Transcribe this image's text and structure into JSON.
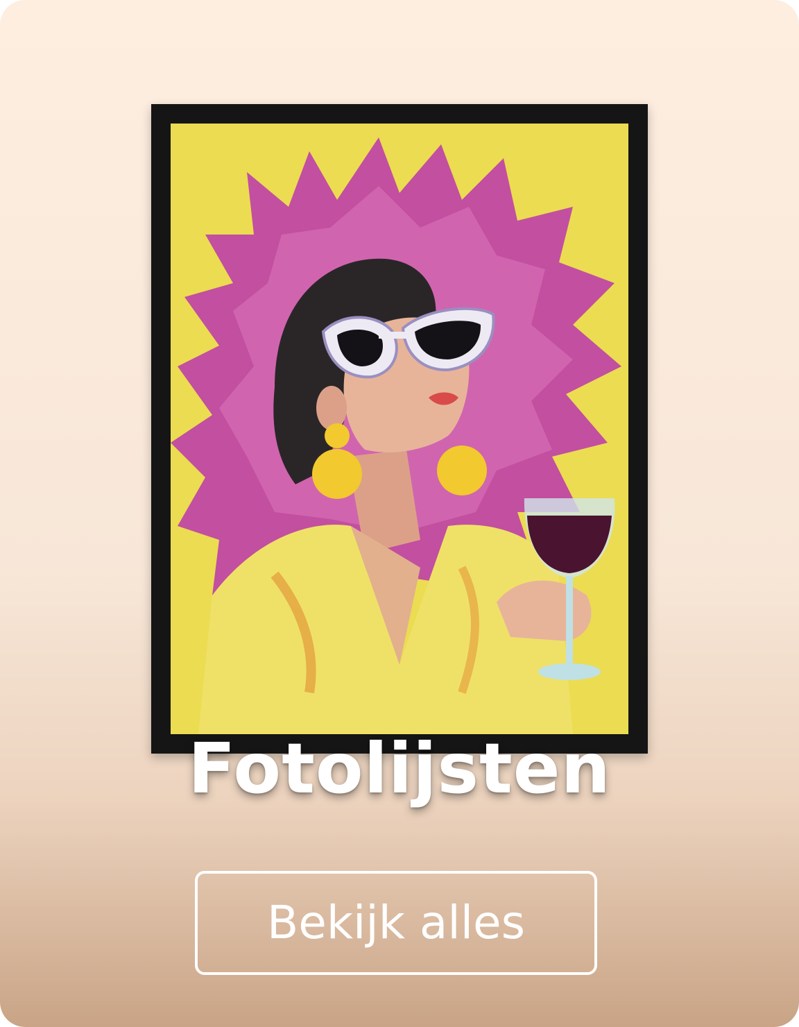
{
  "card": {
    "title": "Fotolijsten",
    "cta_label": "Bekijk alles"
  },
  "artwork": {
    "icon": "framed-poster-image",
    "colors": {
      "frame": "#151515",
      "background": "#e9d84a",
      "splash": "#c24fa0",
      "hair": "#2a2628",
      "skin": "#e7b49a",
      "dress": "#efe168",
      "earring": "#f2c92e",
      "wine": "#4a1330"
    }
  },
  "theme": {
    "card_gradient_top": "#fdeee0",
    "card_gradient_bottom": "#c9a486",
    "text": "#ffffff"
  }
}
